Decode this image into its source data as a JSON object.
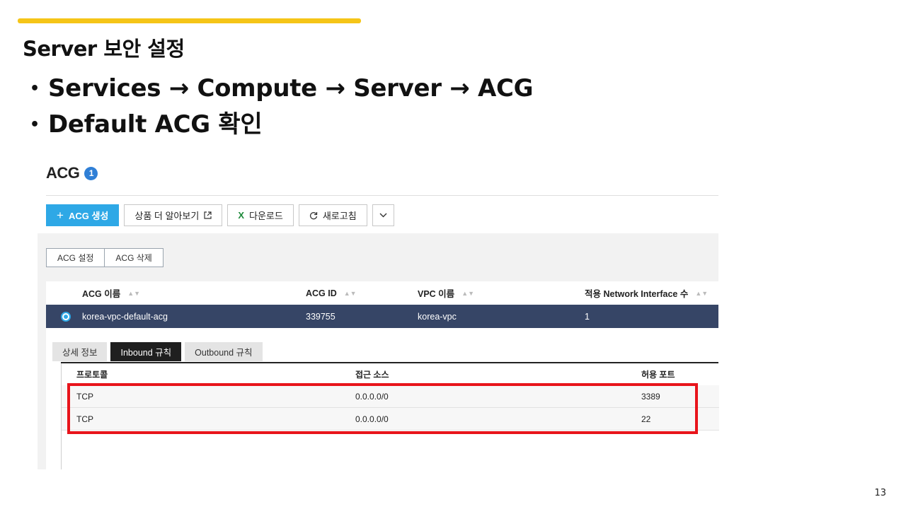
{
  "slide": {
    "title": "Server 보안 설정",
    "bullets": [
      "Services → Compute → Server → ACG",
      "Default ACG 확인"
    ],
    "page_number": "13"
  },
  "console": {
    "title": "ACG",
    "count_badge": "1",
    "toolbar": {
      "create_label": "ACG 생성",
      "learn_more_label": "상품 더 알아보기",
      "download_label": "다운로드",
      "refresh_label": "새로고침"
    },
    "subactions": {
      "settings_label": "ACG 설정",
      "delete_label": "ACG 삭제"
    },
    "grid": {
      "columns": [
        "ACG 이름",
        "ACG ID",
        "VPC 이름",
        "적용 Network Interface 수"
      ],
      "rows": [
        {
          "name": "korea-vpc-default-acg",
          "id": "339755",
          "vpc": "korea-vpc",
          "nic_count": "1",
          "selected": true
        }
      ]
    },
    "tabs": [
      {
        "label": "상세 정보",
        "active": false
      },
      {
        "label": "Inbound 규칙",
        "active": true
      },
      {
        "label": "Outbound 규칙",
        "active": false
      }
    ],
    "rules": {
      "columns": [
        "프로토콜",
        "접근 소스",
        "허용 포트"
      ],
      "rows": [
        {
          "protocol": "TCP",
          "source": "0.0.0.0/0",
          "port": "3389"
        },
        {
          "protocol": "TCP",
          "source": "0.0.0.0/0",
          "port": "22"
        }
      ]
    }
  },
  "colors": {
    "accent_bar": "#f5c518",
    "primary_button": "#2ea8e6",
    "selected_row": "#364566",
    "highlight_box": "#e8141b"
  }
}
